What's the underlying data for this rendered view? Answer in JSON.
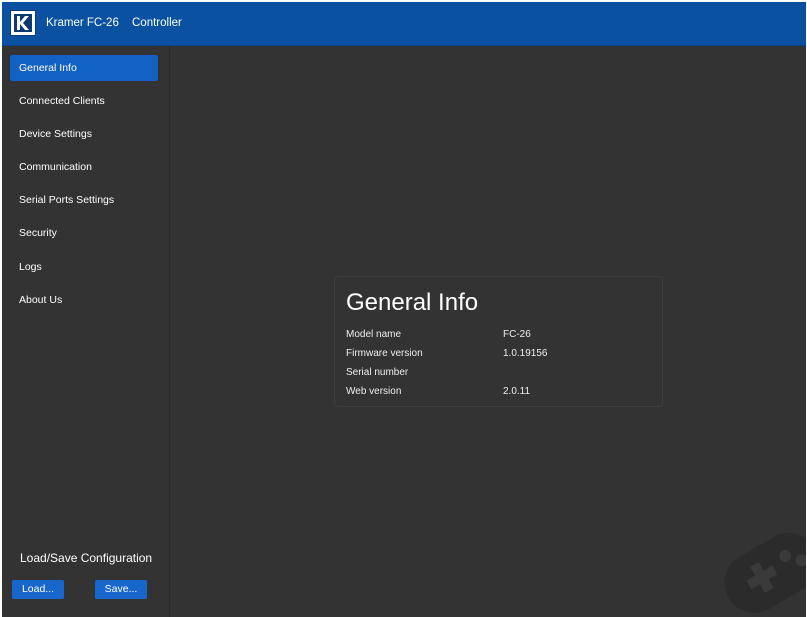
{
  "header": {
    "app_title": "Kramer FC-26",
    "subtitle": "Controller",
    "logo_icon": "kramer-logo-icon"
  },
  "sidebar": {
    "items": [
      {
        "label": "General Info",
        "active": true
      },
      {
        "label": "Connected Clients",
        "active": false
      },
      {
        "label": "Device Settings",
        "active": false
      },
      {
        "label": "Communication",
        "active": false
      },
      {
        "label": "Serial Ports Settings",
        "active": false
      },
      {
        "label": "Security",
        "active": false
      },
      {
        "label": "Logs",
        "active": false
      },
      {
        "label": "About Us",
        "active": false
      }
    ],
    "config_title": "Load/Save Configuration",
    "load_label": "Load...",
    "save_label": "Save..."
  },
  "panel": {
    "title": "General Info",
    "rows": [
      {
        "label": "Model name",
        "value": "FC-26"
      },
      {
        "label": "Firmware version",
        "value": "1.0.19156"
      },
      {
        "label": "Serial number",
        "value": ""
      },
      {
        "label": "Web version",
        "value": "2.0.11"
      }
    ]
  },
  "colors": {
    "header": "#0a52a1",
    "active_item": "#1262c4",
    "background": "#333333"
  }
}
